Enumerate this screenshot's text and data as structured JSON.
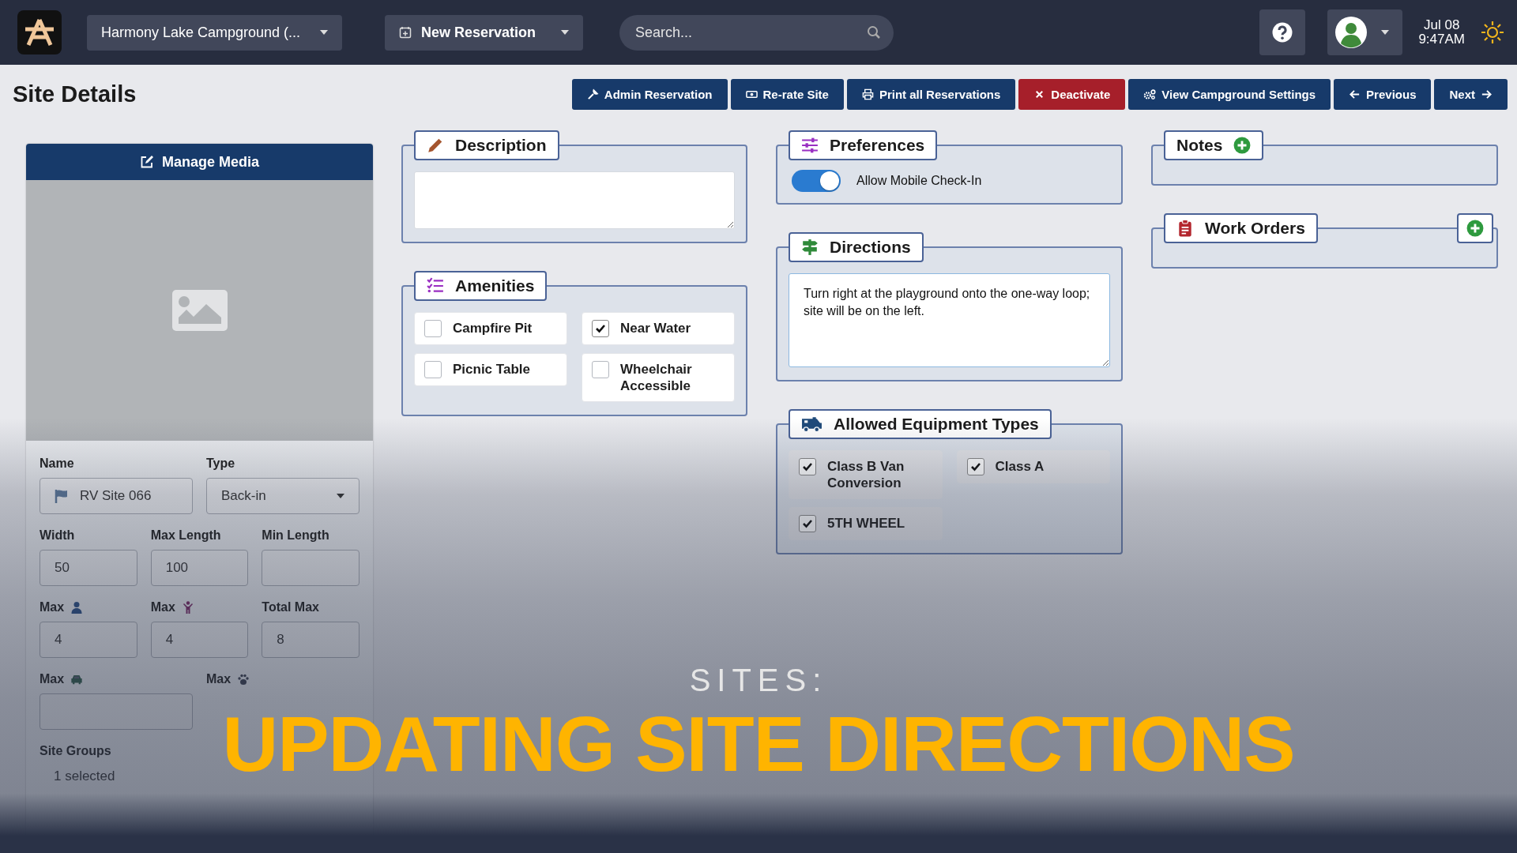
{
  "top_bar": {
    "campground": "Harmony Lake Campground (...",
    "new_reservation": "New Reservation",
    "search": {
      "placeholder": "Search..."
    },
    "date": "Jul 08",
    "time": "9:47AM"
  },
  "page_title": "Site Details",
  "actions": [
    {
      "label": "Admin Reservation",
      "kind": "wrench",
      "color": "#173a6a"
    },
    {
      "label": "Re-rate Site",
      "kind": "money",
      "color": "#173a6a"
    },
    {
      "label": "Print all Reservations",
      "kind": "print",
      "color": "#173a6a"
    },
    {
      "label": "Deactivate",
      "kind": "close",
      "color": "#a61f2a"
    },
    {
      "label": "View Campground Settings",
      "kind": "gears",
      "color": "#173a6a"
    },
    {
      "label": "Previous",
      "kind": "back",
      "color": "#173a6a"
    },
    {
      "label": "Next",
      "kind": "next",
      "color": "#173a6a"
    }
  ],
  "media": {
    "title": "Manage Media"
  },
  "site_form": {
    "rows": [
      [
        {
          "label": "Name",
          "kind": "name",
          "value": "RV Site 066"
        },
        {
          "label": "Type",
          "kind": "select",
          "value": "Back-in"
        }
      ],
      [
        {
          "label": "Width",
          "kind": "number",
          "value": "50"
        },
        {
          "label": "Max Length",
          "kind": "number",
          "value": "100"
        },
        {
          "label": "Min Length",
          "kind": "number"
        }
      ],
      [
        {
          "label": "Max",
          "kind": "adults",
          "value": "4"
        },
        {
          "label": "Max",
          "kind": "children",
          "value": "4"
        },
        {
          "label": "Total Max",
          "kind": "number",
          "value": "8"
        }
      ],
      [
        {
          "label": "Max",
          "kind": "vehicles"
        },
        {
          "label": "Max",
          "kind": "pets"
        }
      ],
      [
        {
          "label": "Site Groups",
          "kind": "group",
          "value": "1 selected"
        }
      ]
    ]
  },
  "description": {
    "title": "Description"
  },
  "amenities": {
    "title": "Amenities",
    "items": [
      {
        "label": "Campfire Pit",
        "checked": false
      },
      {
        "label": "Near Water",
        "checked": true
      },
      {
        "label": "Picnic Table",
        "checked": false
      },
      {
        "label": "Wheelchair Accessible",
        "checked": false
      }
    ]
  },
  "preferences": {
    "title": "Preferences",
    "toggles": [
      {
        "label": "Allow Mobile Check-In",
        "on": true
      }
    ]
  },
  "directions": {
    "title": "Directions",
    "value": "Turn right at the playground onto the one-way loop; site will be on the left."
  },
  "equipment": {
    "title": "Allowed Equipment Types",
    "items": [
      {
        "label": "Class B Van Conversion",
        "checked": true
      },
      {
        "label": "Class A",
        "checked": true
      },
      {
        "label": "5TH WHEEL",
        "checked": true
      }
    ]
  },
  "notes": {
    "title": "Notes"
  },
  "work_orders": {
    "title": "Work Orders"
  },
  "overlay": {
    "subtitle": "SITES:",
    "title": "UPDATING SITE DIRECTIONS"
  }
}
